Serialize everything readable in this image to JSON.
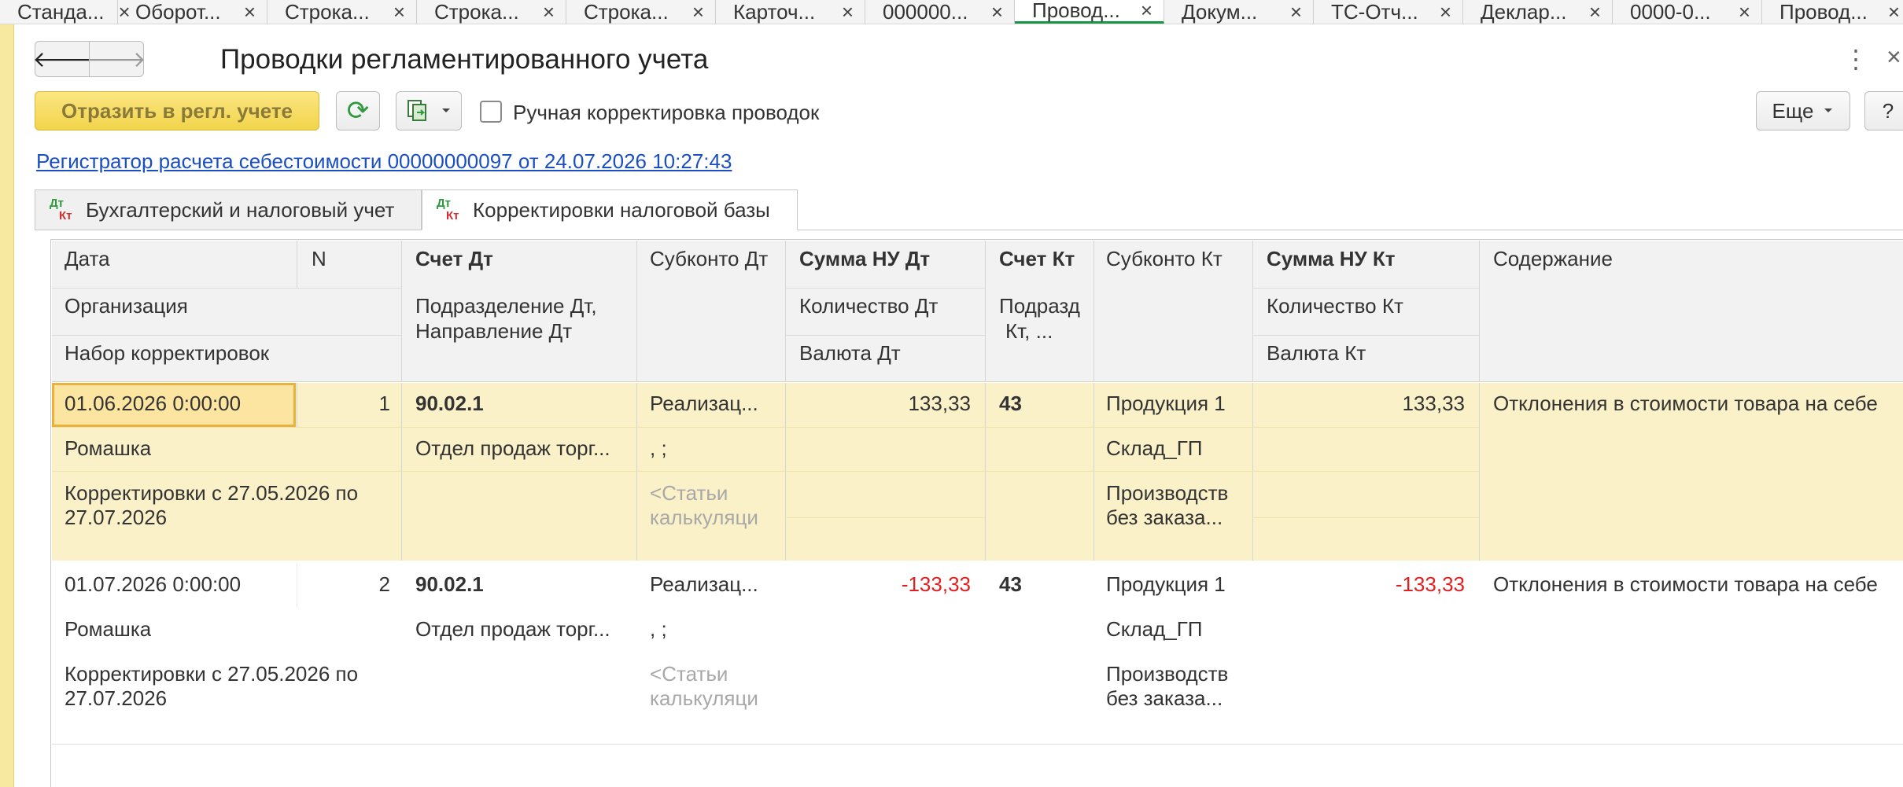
{
  "tabs": [
    {
      "label": "Станда...",
      "active": false
    },
    {
      "label": "Оборот...",
      "active": false
    },
    {
      "label": "Строка...",
      "active": false
    },
    {
      "label": "Строка...",
      "active": false
    },
    {
      "label": "Строка...",
      "active": false
    },
    {
      "label": "Карточ...",
      "active": false
    },
    {
      "label": "000000...",
      "active": false
    },
    {
      "label": "Провод...",
      "active": true
    },
    {
      "label": "Докум...",
      "active": false
    },
    {
      "label": "ТС-Отч...",
      "active": false
    },
    {
      "label": "Деклар...",
      "active": false
    },
    {
      "label": "0000-0...",
      "active": false
    },
    {
      "label": "Провод...",
      "active": false
    }
  ],
  "window": {
    "title": "Проводки регламентированного учета",
    "back_icon": "🡐",
    "forward_icon": "🡒",
    "more_icon": "⋮",
    "close_icon": "×"
  },
  "toolbar": {
    "reflect_label": "Отразить в регл. учете",
    "refresh_icon": "⟳",
    "manual_label": "Ручная корректировка проводок",
    "manual_checked": false,
    "more_label": "Еще",
    "help_label": "?"
  },
  "registrar_link": "Регистратор расчета себестоимости 00000000097 от 24.07.2026 10:27:43",
  "form_tabs": [
    {
      "dt": "Дт",
      "kt": "Кт",
      "label": "Бухгалтерский и налоговый учет",
      "active": false
    },
    {
      "dt": "Дт",
      "kt": "Кт",
      "label": "Корректировки налоговой базы",
      "active": true
    }
  ],
  "table": {
    "headers": {
      "date": "Дата",
      "n": "N",
      "account_dt": "Счет Дт",
      "subconto_dt": "Субконто Дт",
      "sum_nu_dt": "Сумма НУ Дт",
      "account_kt": "Счет Кт",
      "subconto_kt": "Субконто Кт",
      "sum_nu_kt": "Сумма НУ Кт",
      "content": "Содержание",
      "organization": "Организация",
      "division_dt": "Подразделение Дт,",
      "direction_dt": "Направление Дт",
      "qty_dt": "Количество Дт",
      "division_kt": "Подразд",
      "division_kt2": "Кт, ...",
      "qty_kt": "Количество Кт",
      "correction_set": "Набор корректировок",
      "currency_dt": "Валюта Дт",
      "currency_kt": "Валюта Кт"
    },
    "rows": [
      {
        "date": "01.06.2026 0:00:00",
        "n": "1",
        "account_dt": "90.02.1",
        "subconto_dt_1": "Реализац...",
        "subconto_dt_2": ", ;",
        "subconto_dt_3a": "<Статьи",
        "subconto_dt_3b": "калькуляци",
        "sum_nu_dt": "133,33",
        "account_kt": "43",
        "subconto_kt_1": "Продукция 1",
        "subconto_kt_2": "Склад_ГП",
        "subconto_kt_3a": "Производств",
        "subconto_kt_3b": " без заказа...",
        "sum_nu_kt": "133,33",
        "content": "Отклонения в стоимости товара на себе",
        "organization": "Ромашка",
        "division_dt": "Отдел продаж торг...",
        "correction_set_1": "Корректировки с 27.05.2026 по",
        "correction_set_2": "27.07.2026"
      },
      {
        "date": "01.07.2026 0:00:00",
        "n": "2",
        "account_dt": "90.02.1",
        "subconto_dt_1": "Реализац...",
        "subconto_dt_2": ", ;",
        "subconto_dt_3a": "<Статьи",
        "subconto_dt_3b": "калькуляци",
        "sum_nu_dt": "-133,33",
        "account_kt": "43",
        "subconto_kt_1": "Продукция 1",
        "subconto_kt_2": "Склад_ГП",
        "subconto_kt_3a": "Производств",
        "subconto_kt_3b": " без заказа...",
        "sum_nu_kt": "-133,33",
        "content": "Отклонения в стоимости товара на себе",
        "organization": "Ромашка",
        "division_dt": "Отдел продаж торг...",
        "correction_set_1": "Корректировки с 27.05.2026 по",
        "correction_set_2": "27.07.2026"
      }
    ]
  },
  "colors": {
    "accent_green": "#1a9646",
    "button_yellow": "#f2d44b",
    "row_selected": "#fbf1c8",
    "negative": "#e02020",
    "link": "#1a4fc2"
  }
}
